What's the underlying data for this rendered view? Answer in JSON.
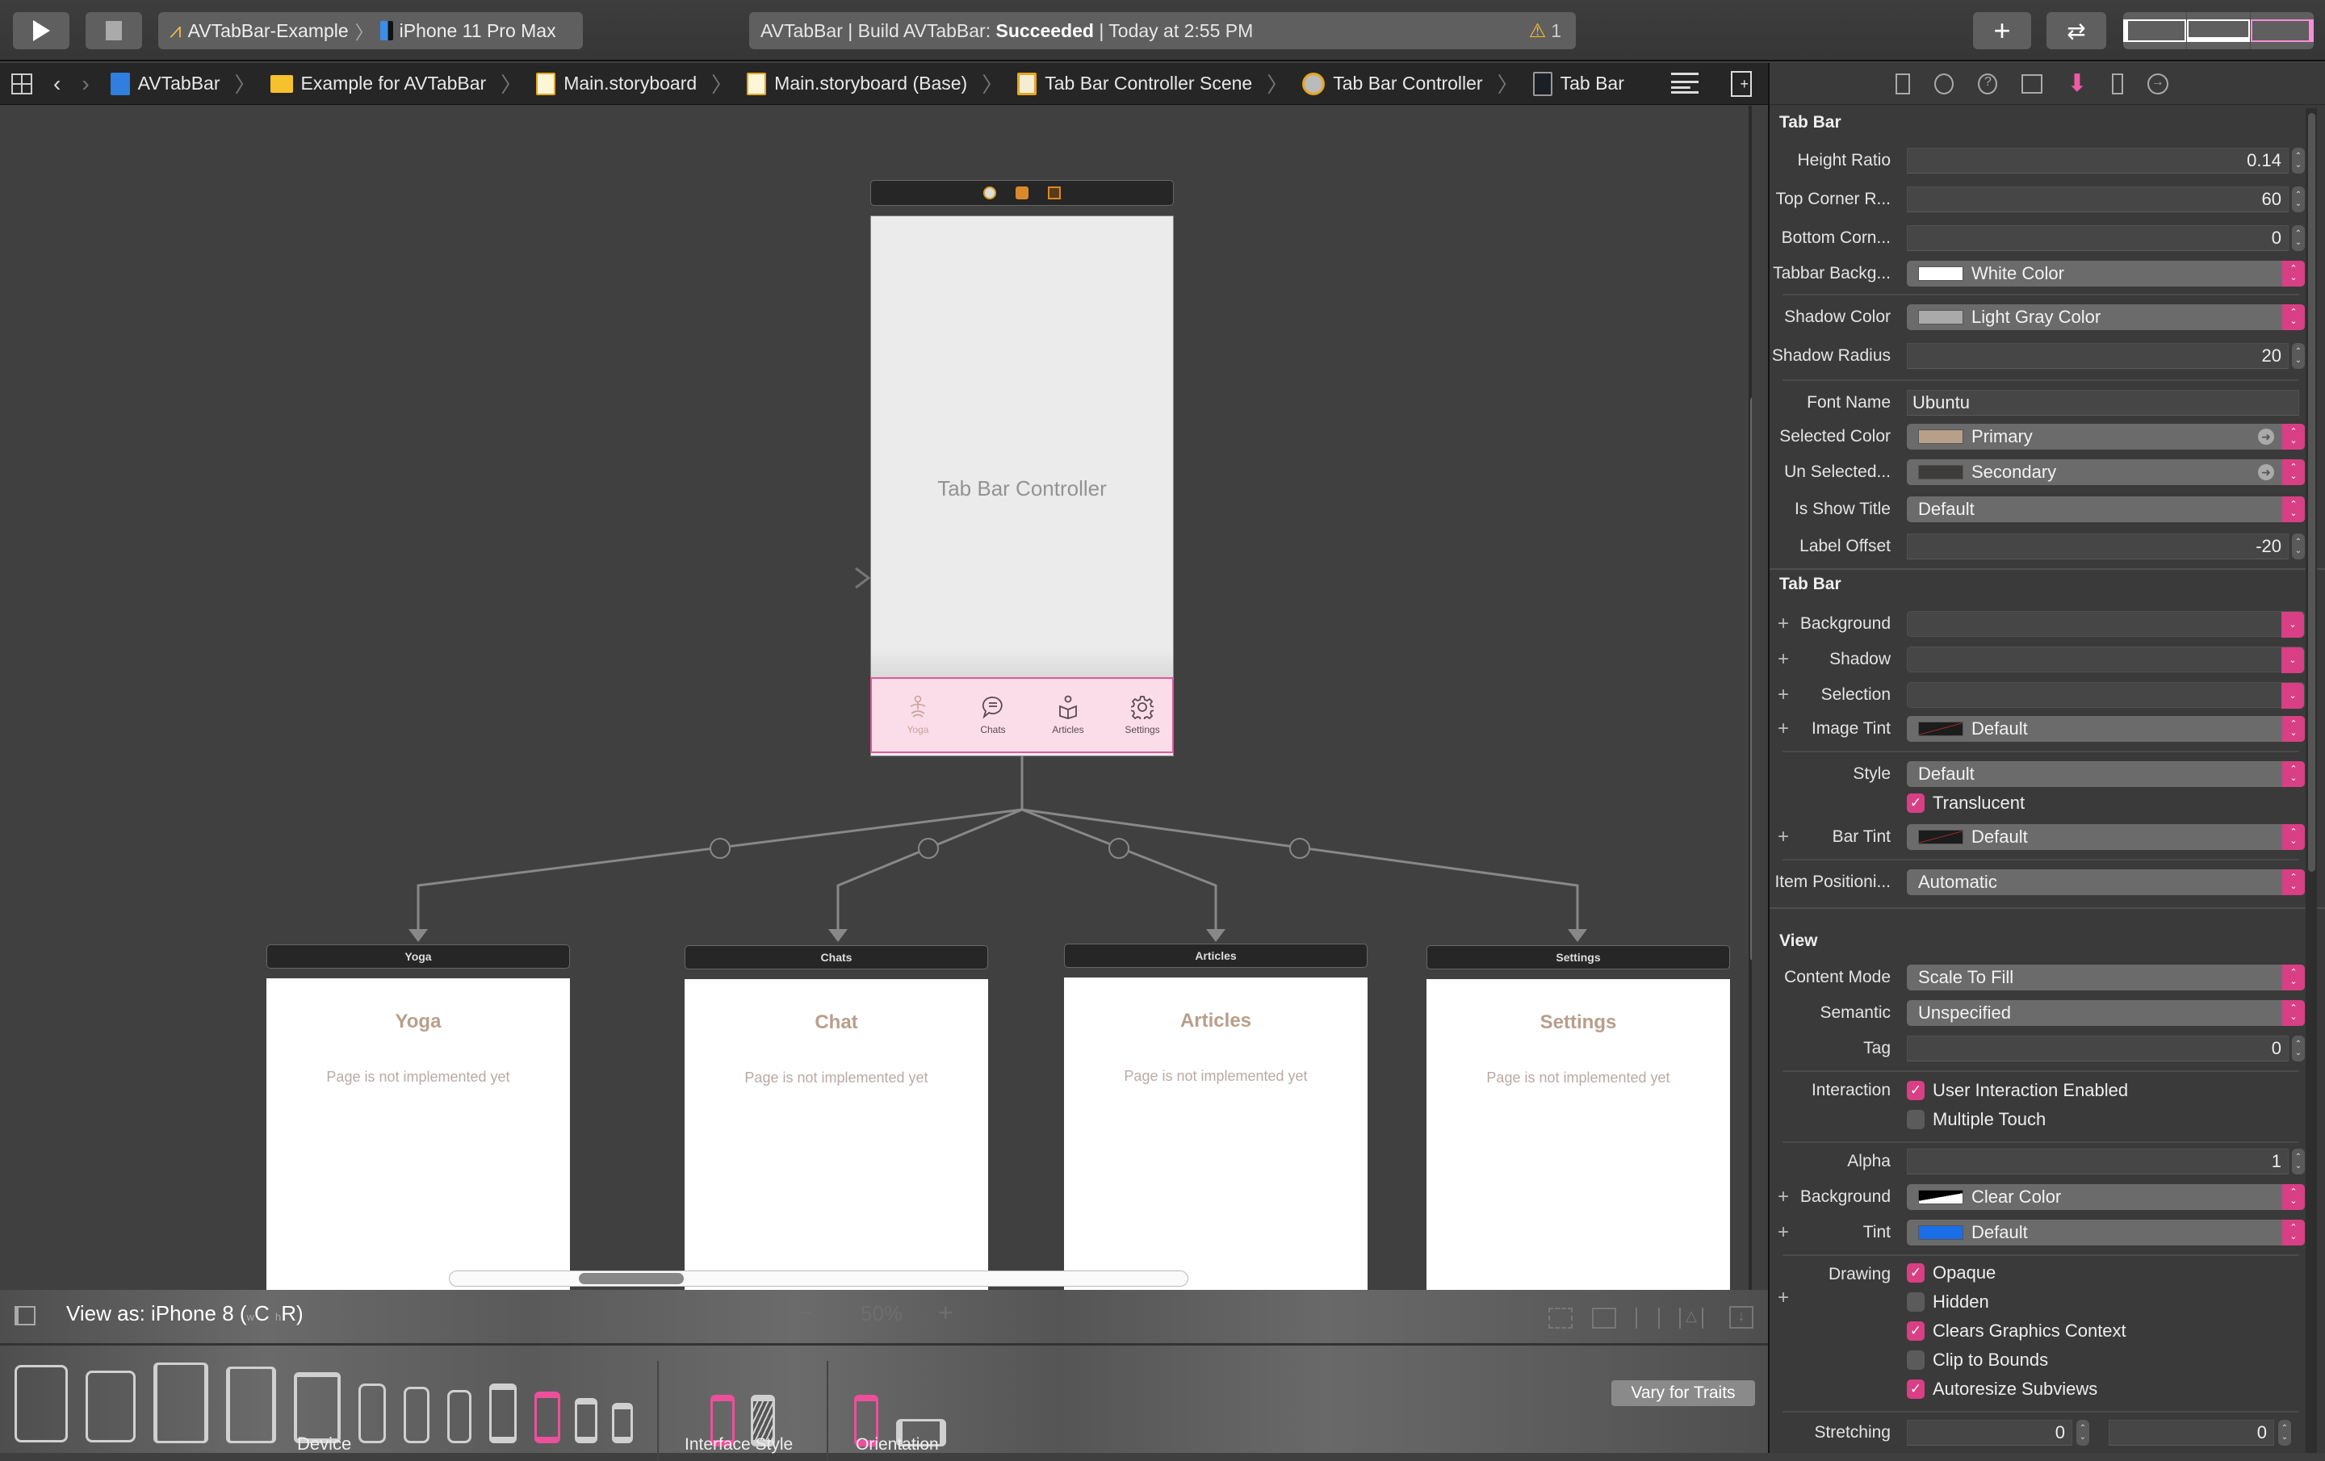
{
  "toolbar": {
    "run_label": "Run",
    "stop_label": "Stop",
    "scheme": "AVTabBar-Example",
    "destination": "iPhone 11 Pro Max",
    "status_prefix": "AVTabBar | Build AVTabBar: ",
    "status_result": "Succeeded",
    "status_suffix": " | Today at 2:55 PM",
    "warning_count": "1",
    "library_icon": "plus-icon",
    "review_icon": "swap-arrows-icon",
    "panels": [
      "navigator-toggle",
      "debug-area-toggle",
      "inspector-toggle"
    ]
  },
  "jumpbar": {
    "crumbs": [
      {
        "label": "AVTabBar",
        "icon": "project-icon"
      },
      {
        "label": "Example for AVTabBar",
        "icon": "folder-icon"
      },
      {
        "label": "Main.storyboard",
        "icon": "storyboard-icon"
      },
      {
        "label": "Main.storyboard (Base)",
        "icon": "storyboard-icon"
      },
      {
        "label": "Tab Bar Controller Scene",
        "icon": "scene-icon"
      },
      {
        "label": "Tab Bar Controller",
        "icon": "tab-bar-controller-icon"
      },
      {
        "label": "Tab Bar",
        "icon": "tab-bar-icon"
      }
    ]
  },
  "canvas": {
    "controller_label": "Tab Bar Controller",
    "tabs": [
      {
        "label": "Yoga",
        "selected": true
      },
      {
        "label": "Chats",
        "selected": false
      },
      {
        "label": "Articles",
        "selected": false
      },
      {
        "label": "Settings",
        "selected": false
      }
    ],
    "scenes": [
      {
        "header": "Yoga",
        "title": "Yoga",
        "subtitle": "Page is not implemented yet"
      },
      {
        "header": "Chats",
        "title": "Chat",
        "subtitle": "Page is not implemented yet"
      },
      {
        "header": "Articles",
        "title": "Articles",
        "subtitle": "Page is not implemented yet"
      },
      {
        "header": "Settings",
        "title": "Settings",
        "subtitle": "Page is not implemented yet"
      }
    ]
  },
  "bottombar": {
    "view_as": "View as: iPhone 8 (",
    "w_class": "w",
    "w_val": "C",
    "h_class": "h",
    "h_val": "R)",
    "zoom": "50%",
    "device_label": "Device",
    "interface_style_label": "Interface Style",
    "orientation_label": "Orientation",
    "vary_for_traits": "Vary for Traits"
  },
  "inspector": {
    "custom_section": "Tab Bar",
    "height_ratio": {
      "label": "Height Ratio",
      "value": "0.14"
    },
    "top_corner": {
      "label": "Top Corner R...",
      "value": "60"
    },
    "bottom_corner": {
      "label": "Bottom Corn...",
      "value": "0"
    },
    "tabbar_bg": {
      "label": "Tabbar Backg...",
      "value": "White Color",
      "swatch": "#ffffff"
    },
    "shadow_color": {
      "label": "Shadow Color",
      "value": "Light Gray Color",
      "swatch": "#aaaaaa"
    },
    "shadow_radius": {
      "label": "Shadow Radius",
      "value": "20"
    },
    "font_name": {
      "label": "Font Name",
      "value": "Ubuntu"
    },
    "selected_color": {
      "label": "Selected Color",
      "value": "Primary",
      "swatch": "#b89f8a"
    },
    "unselected_color": {
      "label": "Un Selected...",
      "value": "Secondary",
      "swatch": "#3e3b3b"
    },
    "show_title": {
      "label": "Is Show Title",
      "value": "Default"
    },
    "label_offset": {
      "label": "Label Offset",
      "value": "-20"
    },
    "tabbar_section": "Tab Bar",
    "background": {
      "label": "Background",
      "value": ""
    },
    "shadow": {
      "label": "Shadow",
      "value": ""
    },
    "selection": {
      "label": "Selection",
      "value": ""
    },
    "image_tint": {
      "label": "Image Tint",
      "value": "Default"
    },
    "style": {
      "label": "Style",
      "value": "Default"
    },
    "translucent": {
      "label": "Translucent",
      "checked": true
    },
    "bar_tint": {
      "label": "Bar Tint",
      "value": "Default"
    },
    "item_positioning": {
      "label": "Item Positioni...",
      "value": "Automatic"
    },
    "view_section": "View",
    "content_mode": {
      "label": "Content Mode",
      "value": "Scale To Fill"
    },
    "semantic": {
      "label": "Semantic",
      "value": "Unspecified"
    },
    "tag": {
      "label": "Tag",
      "value": "0"
    },
    "interaction_label": "Interaction",
    "user_interaction": {
      "label": "User Interaction Enabled",
      "checked": true
    },
    "multiple_touch": {
      "label": "Multiple Touch",
      "checked": false
    },
    "alpha": {
      "label": "Alpha",
      "value": "1"
    },
    "view_background": {
      "label": "Background",
      "value": "Clear Color"
    },
    "tint": {
      "label": "Tint",
      "value": "Default",
      "swatch": "#1a6fe8"
    },
    "drawing_label": "Drawing",
    "opaque": {
      "label": "Opaque",
      "checked": true
    },
    "hidden": {
      "label": "Hidden",
      "checked": false
    },
    "clears_graphics": {
      "label": "Clears Graphics Context",
      "checked": true
    },
    "clip_bounds": {
      "label": "Clip to Bounds",
      "checked": false
    },
    "autoresize": {
      "label": "Autoresize Subviews",
      "checked": true
    },
    "stretching": {
      "label": "Stretching",
      "x": "0",
      "y": "0"
    }
  },
  "colors": {
    "accent": "#d83f84",
    "tab_bar_bg": "#fbdde9",
    "primary": "#b89f8a"
  }
}
